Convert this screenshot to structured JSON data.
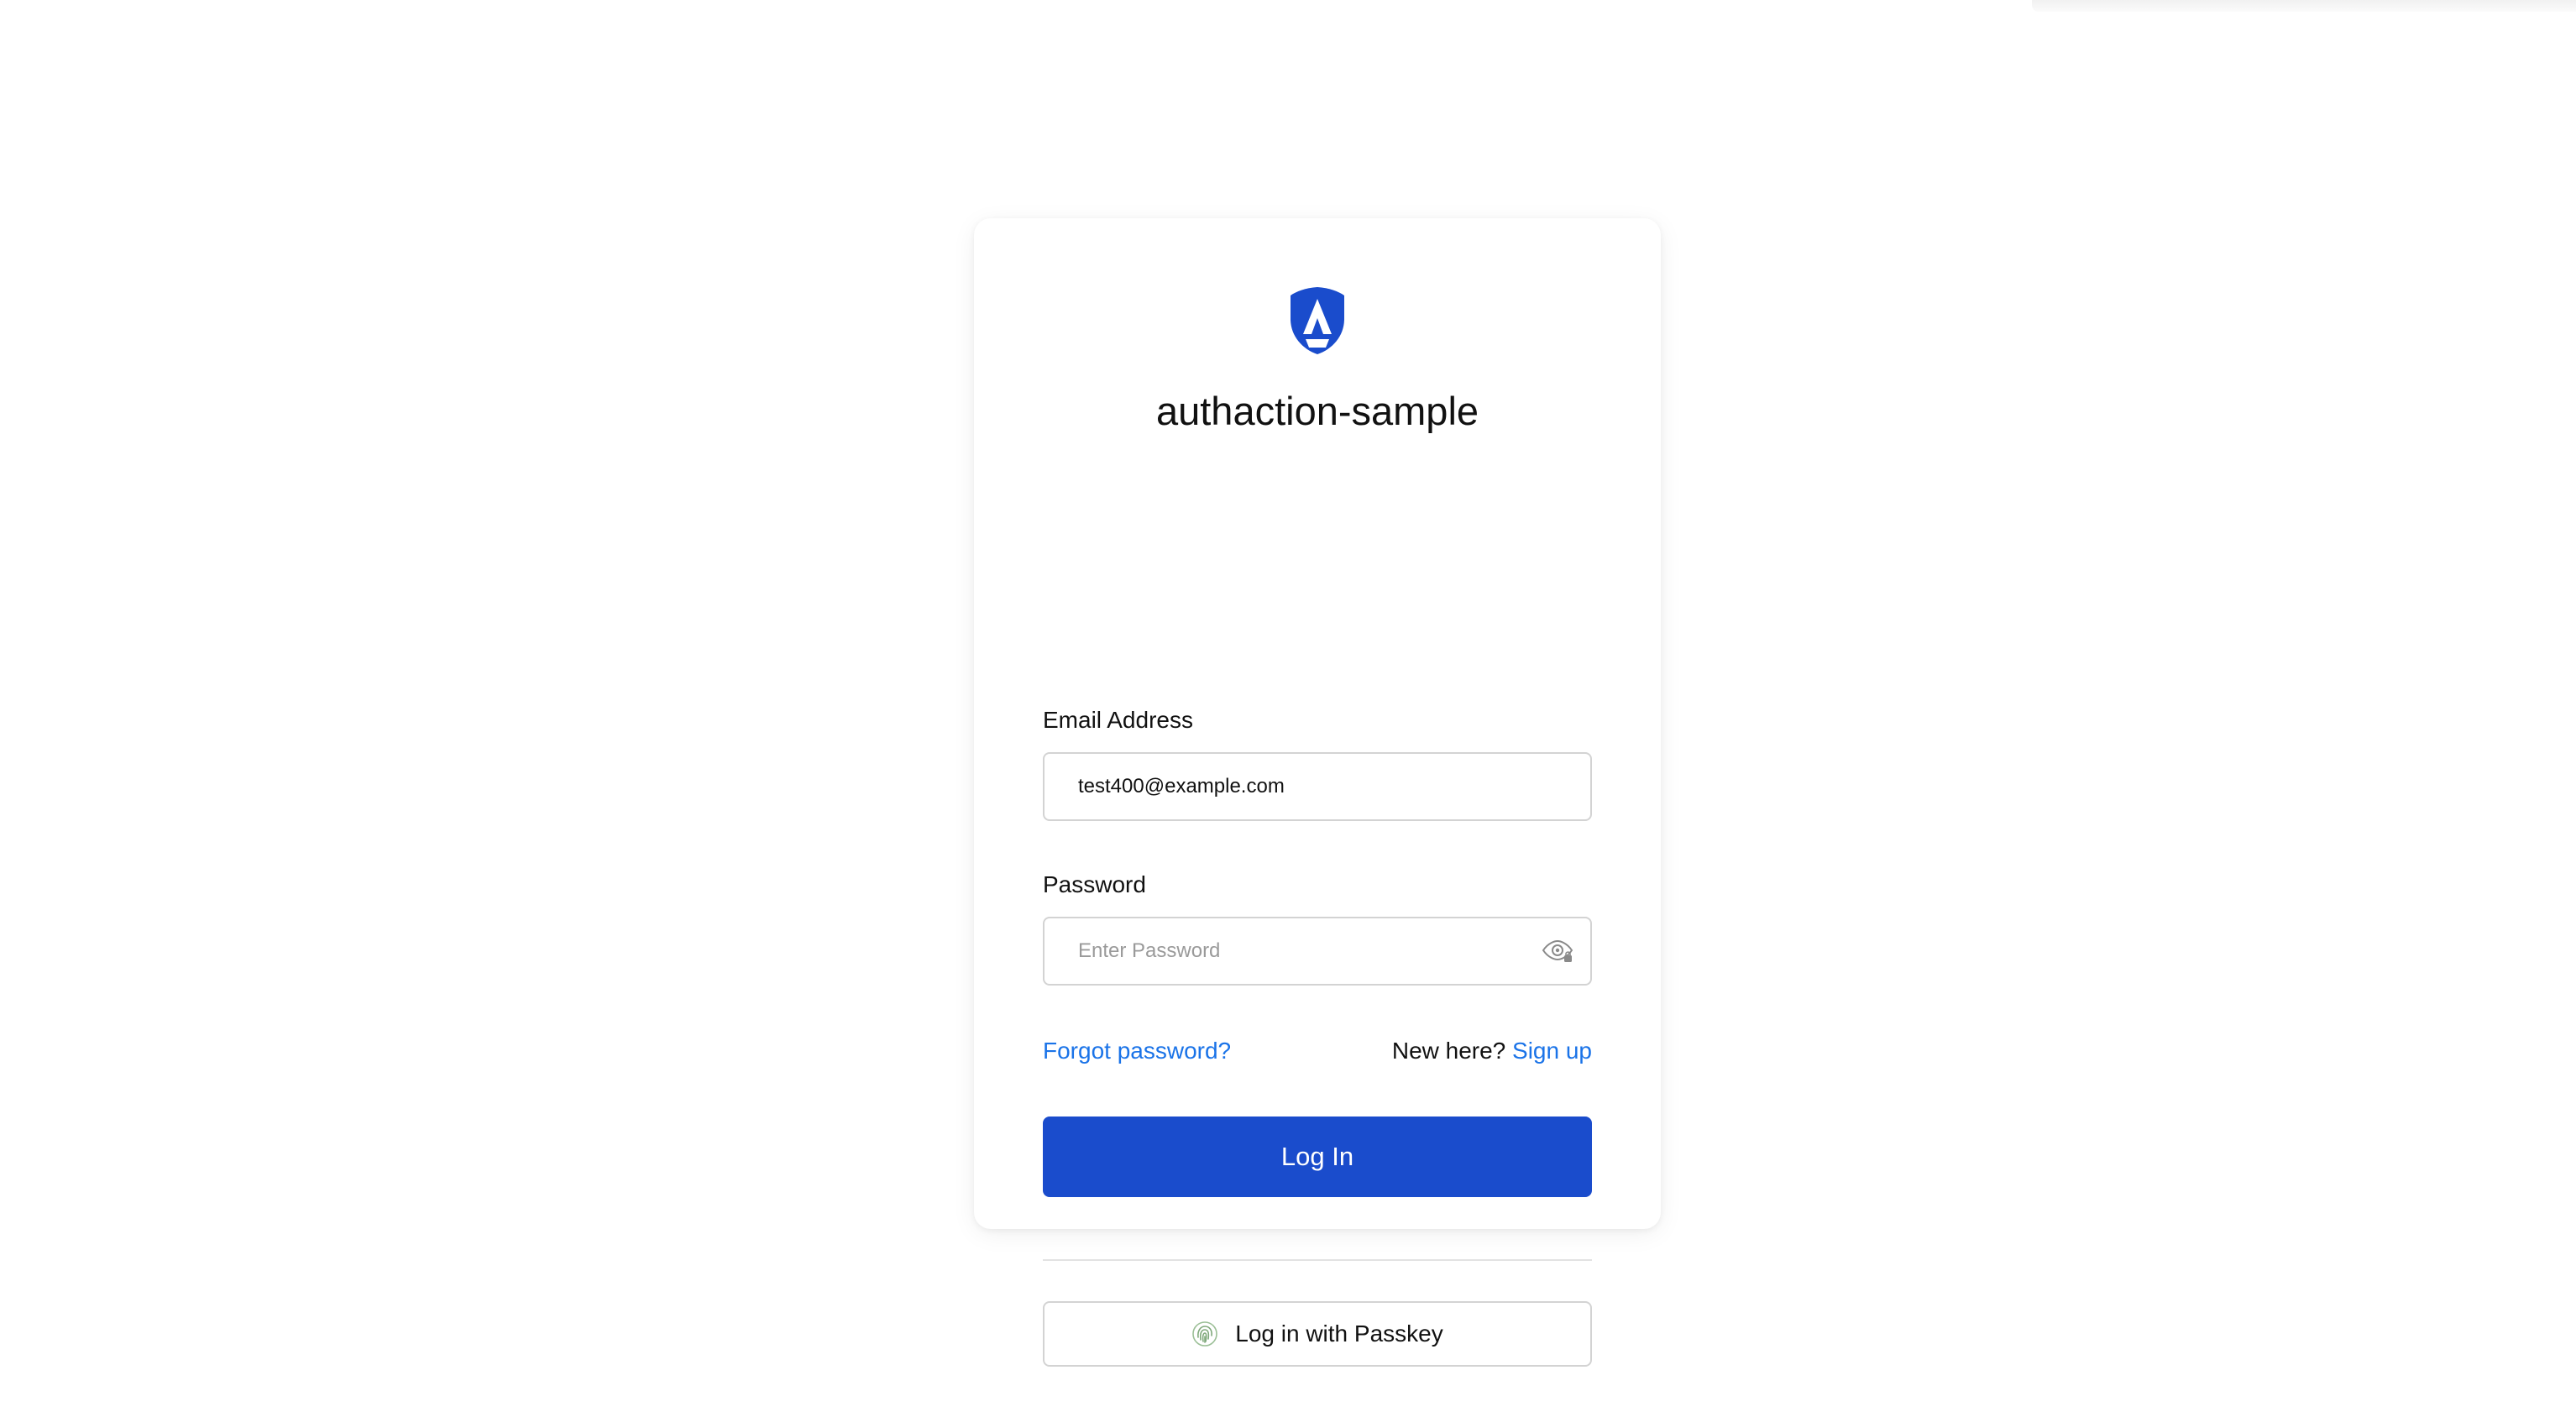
{
  "app": {
    "name": "authaction-sample",
    "brand_color": "#1a4ccc",
    "link_color": "#1a73e8",
    "logo_icon": "shield-logo-icon"
  },
  "form": {
    "email": {
      "label": "Email Address",
      "value": "test400@example.com",
      "placeholder": ""
    },
    "password": {
      "label": "Password",
      "value": "",
      "placeholder": "Enter Password",
      "toggle_icon": "eye-icon"
    },
    "forgot_password": "Forgot password?",
    "signup_prompt": "New here?",
    "signup_link": "Sign up",
    "login_button": "Log In",
    "passkey_button": "Log in with Passkey",
    "passkey_icon": "fingerprint-icon"
  }
}
